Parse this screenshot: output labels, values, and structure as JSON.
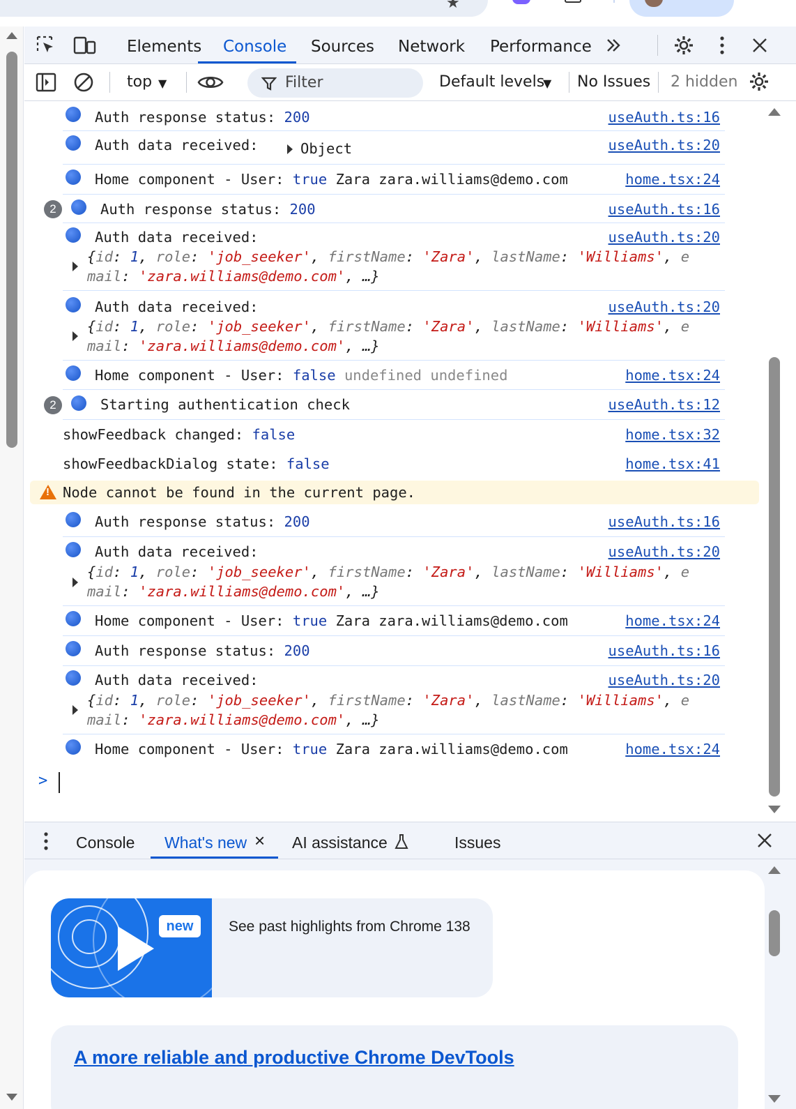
{
  "devtools": {
    "tabs": [
      "Elements",
      "Console",
      "Sources",
      "Network",
      "Performance"
    ],
    "active_tab": "Console",
    "more_tabs_icon": "double-chevron-icon"
  },
  "toolbar": {
    "context": "top",
    "filter_placeholder": "Filter",
    "levels": "Default levels",
    "issues": "No Issues",
    "hidden": "2 hidden"
  },
  "console": {
    "messages": [
      {
        "type": "info",
        "text": "Auth response status:",
        "value": "200",
        "source": "useAuth.ts:16"
      },
      {
        "type": "info",
        "text": "Auth data received:",
        "value": "Object",
        "source": "useAuth.ts:20"
      },
      {
        "type": "info",
        "text": "Home component - User:",
        "bool": "true",
        "rest": "Zara zara.williams@demo.com",
        "source": "home.tsx:24"
      },
      {
        "type": "info",
        "count": "2",
        "text": "Auth response status:",
        "value": "200",
        "source": "useAuth.ts:16"
      },
      {
        "type": "info",
        "text": "Auth data received:",
        "source": "useAuth.ts:20"
      },
      {
        "type": "info",
        "text": "Auth data received:",
        "source": "useAuth.ts:20"
      },
      {
        "type": "info",
        "text": "Home component - User:",
        "bool": "false",
        "rest": "undefined undefined",
        "source": "home.tsx:24"
      },
      {
        "type": "info",
        "count": "2",
        "text": "Starting authentication check",
        "source": "useAuth.ts:12"
      },
      {
        "type": "log",
        "text": "showFeedback changed:",
        "bool": "false",
        "source": "home.tsx:32"
      },
      {
        "type": "log",
        "text": "showFeedbackDialog state:",
        "bool": "false",
        "source": "home.tsx:41"
      },
      {
        "type": "warning",
        "text": "Node cannot be found in the current page."
      },
      {
        "type": "info",
        "text": "Auth response status:",
        "value": "200",
        "source": "useAuth.ts:16"
      },
      {
        "type": "info",
        "text": "Auth data received:",
        "source": "useAuth.ts:20"
      },
      {
        "type": "info",
        "text": "Home component - User:",
        "bool": "true",
        "rest": "Zara zara.williams@demo.com",
        "source": "home.tsx:24"
      },
      {
        "type": "info",
        "text": "Auth response status:",
        "value": "200",
        "source": "useAuth.ts:16"
      },
      {
        "type": "info",
        "text": "Auth data received:",
        "source": "useAuth.ts:20"
      },
      {
        "type": "info",
        "text": "Home component - User:",
        "bool": "true",
        "rest": "Zara zara.williams@demo.com",
        "source": "home.tsx:24"
      }
    ],
    "object_preview": {
      "open": "{",
      "k_id": "id",
      "v_id": "1",
      "k_role": "role",
      "v_role": "'job_seeker'",
      "k_first": "firstName",
      "v_first": "'Zara'",
      "k_last": "lastName",
      "v_last": "'Williams'",
      "k_email_a": "e",
      "k_email_b": "mail",
      "v_email": "'zara.williams@demo.com'",
      "ellipsis": "…}"
    },
    "prompt": ">"
  },
  "drawer": {
    "tabs": [
      "Console",
      "What's new",
      "AI assistance",
      "Issues"
    ],
    "active_tab": "What's new",
    "close_tab_glyph": "×",
    "ai_icon": "flask-icon"
  },
  "whats_new": {
    "badge": "new",
    "highlight": "See past highlights from Chrome 138",
    "headline": "A more reliable and productive Chrome DevTools"
  }
}
